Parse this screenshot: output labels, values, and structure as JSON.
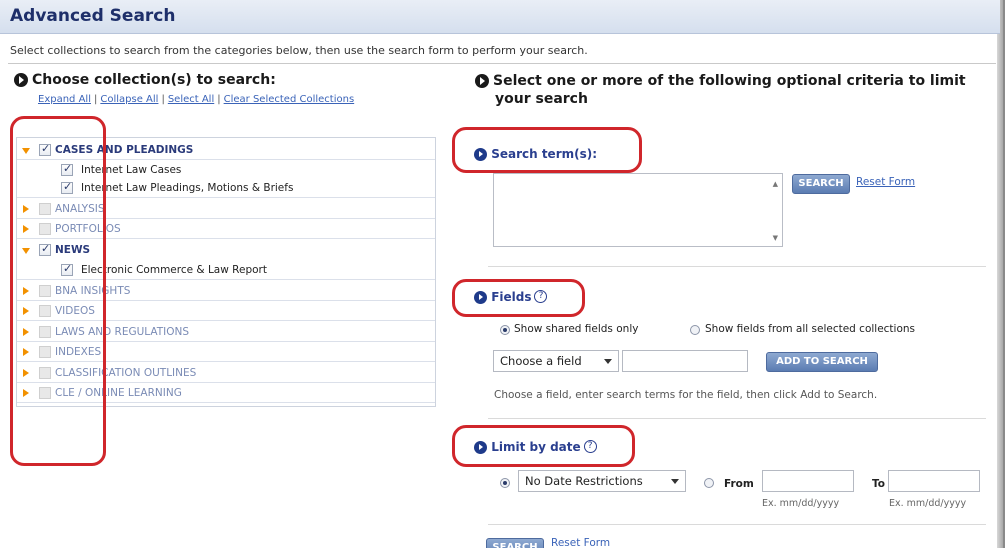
{
  "header": {
    "title": "Advanced Search"
  },
  "intro": "Select collections to search from the categories below, then use the search form to perform your search.",
  "left": {
    "heading": "Choose collection(s) to search:",
    "links": [
      "Expand All",
      "Collapse All",
      "Select All",
      "Clear Selected Collections"
    ],
    "collections": [
      {
        "label": "CASES AND PLEADINGS",
        "expanded": true,
        "checked": true
      },
      {
        "label": "Internet Law Cases",
        "sub": true,
        "checked": true
      },
      {
        "label": "Internet Law Pleadings, Motions & Briefs",
        "sub": true,
        "checked": true
      },
      {
        "label": "ANALYSIS",
        "expanded": false,
        "checked": false
      },
      {
        "label": "PORTFOLIOS",
        "expanded": false,
        "checked": false
      },
      {
        "label": "NEWS",
        "expanded": true,
        "checked": true
      },
      {
        "label": "Electronic Commerce & Law Report",
        "sub": true,
        "checked": true
      },
      {
        "label": "BNA INSIGHTS",
        "expanded": false,
        "checked": false
      },
      {
        "label": "VIDEOS",
        "expanded": false,
        "checked": false
      },
      {
        "label": "LAWS AND REGULATIONS",
        "expanded": false,
        "checked": false
      },
      {
        "label": "INDEXES",
        "expanded": false,
        "checked": false
      },
      {
        "label": "CLASSIFICATION OUTLINES",
        "expanded": false,
        "checked": false
      },
      {
        "label": "CLE / ONLINE LEARNING",
        "expanded": false,
        "checked": false
      }
    ]
  },
  "right": {
    "heading_line1": "Select one or more of the following optional criteria to limit",
    "heading_line2": "your search",
    "search_terms": {
      "label": "Search term(s):",
      "search_button": "SEARCH",
      "reset_link": "Reset Form"
    },
    "fields": {
      "label": "Fields",
      "help": "?",
      "radio_shared": "Show shared fields only",
      "radio_all": "Show fields from all selected collections",
      "choose_field": "Choose a field",
      "add_button": "ADD TO SEARCH",
      "hint": "Choose a field, enter search terms for the field, then click Add to Search."
    },
    "date": {
      "label": "Limit by date",
      "help": "?",
      "select_value": "No Date Restrictions",
      "from_label": "From",
      "to_label": "To",
      "from_hint": "Ex. mm/dd/yyyy",
      "to_hint": "Ex. mm/dd/yyyy"
    },
    "bottom": {
      "search_button": "SEARCH",
      "reset_link": "Reset Form"
    }
  },
  "colors": {
    "accent_red": "#d0262b",
    "title_blue": "#1e2f6a",
    "link_blue": "#3a63b8",
    "arrow_orange": "#f29100"
  }
}
